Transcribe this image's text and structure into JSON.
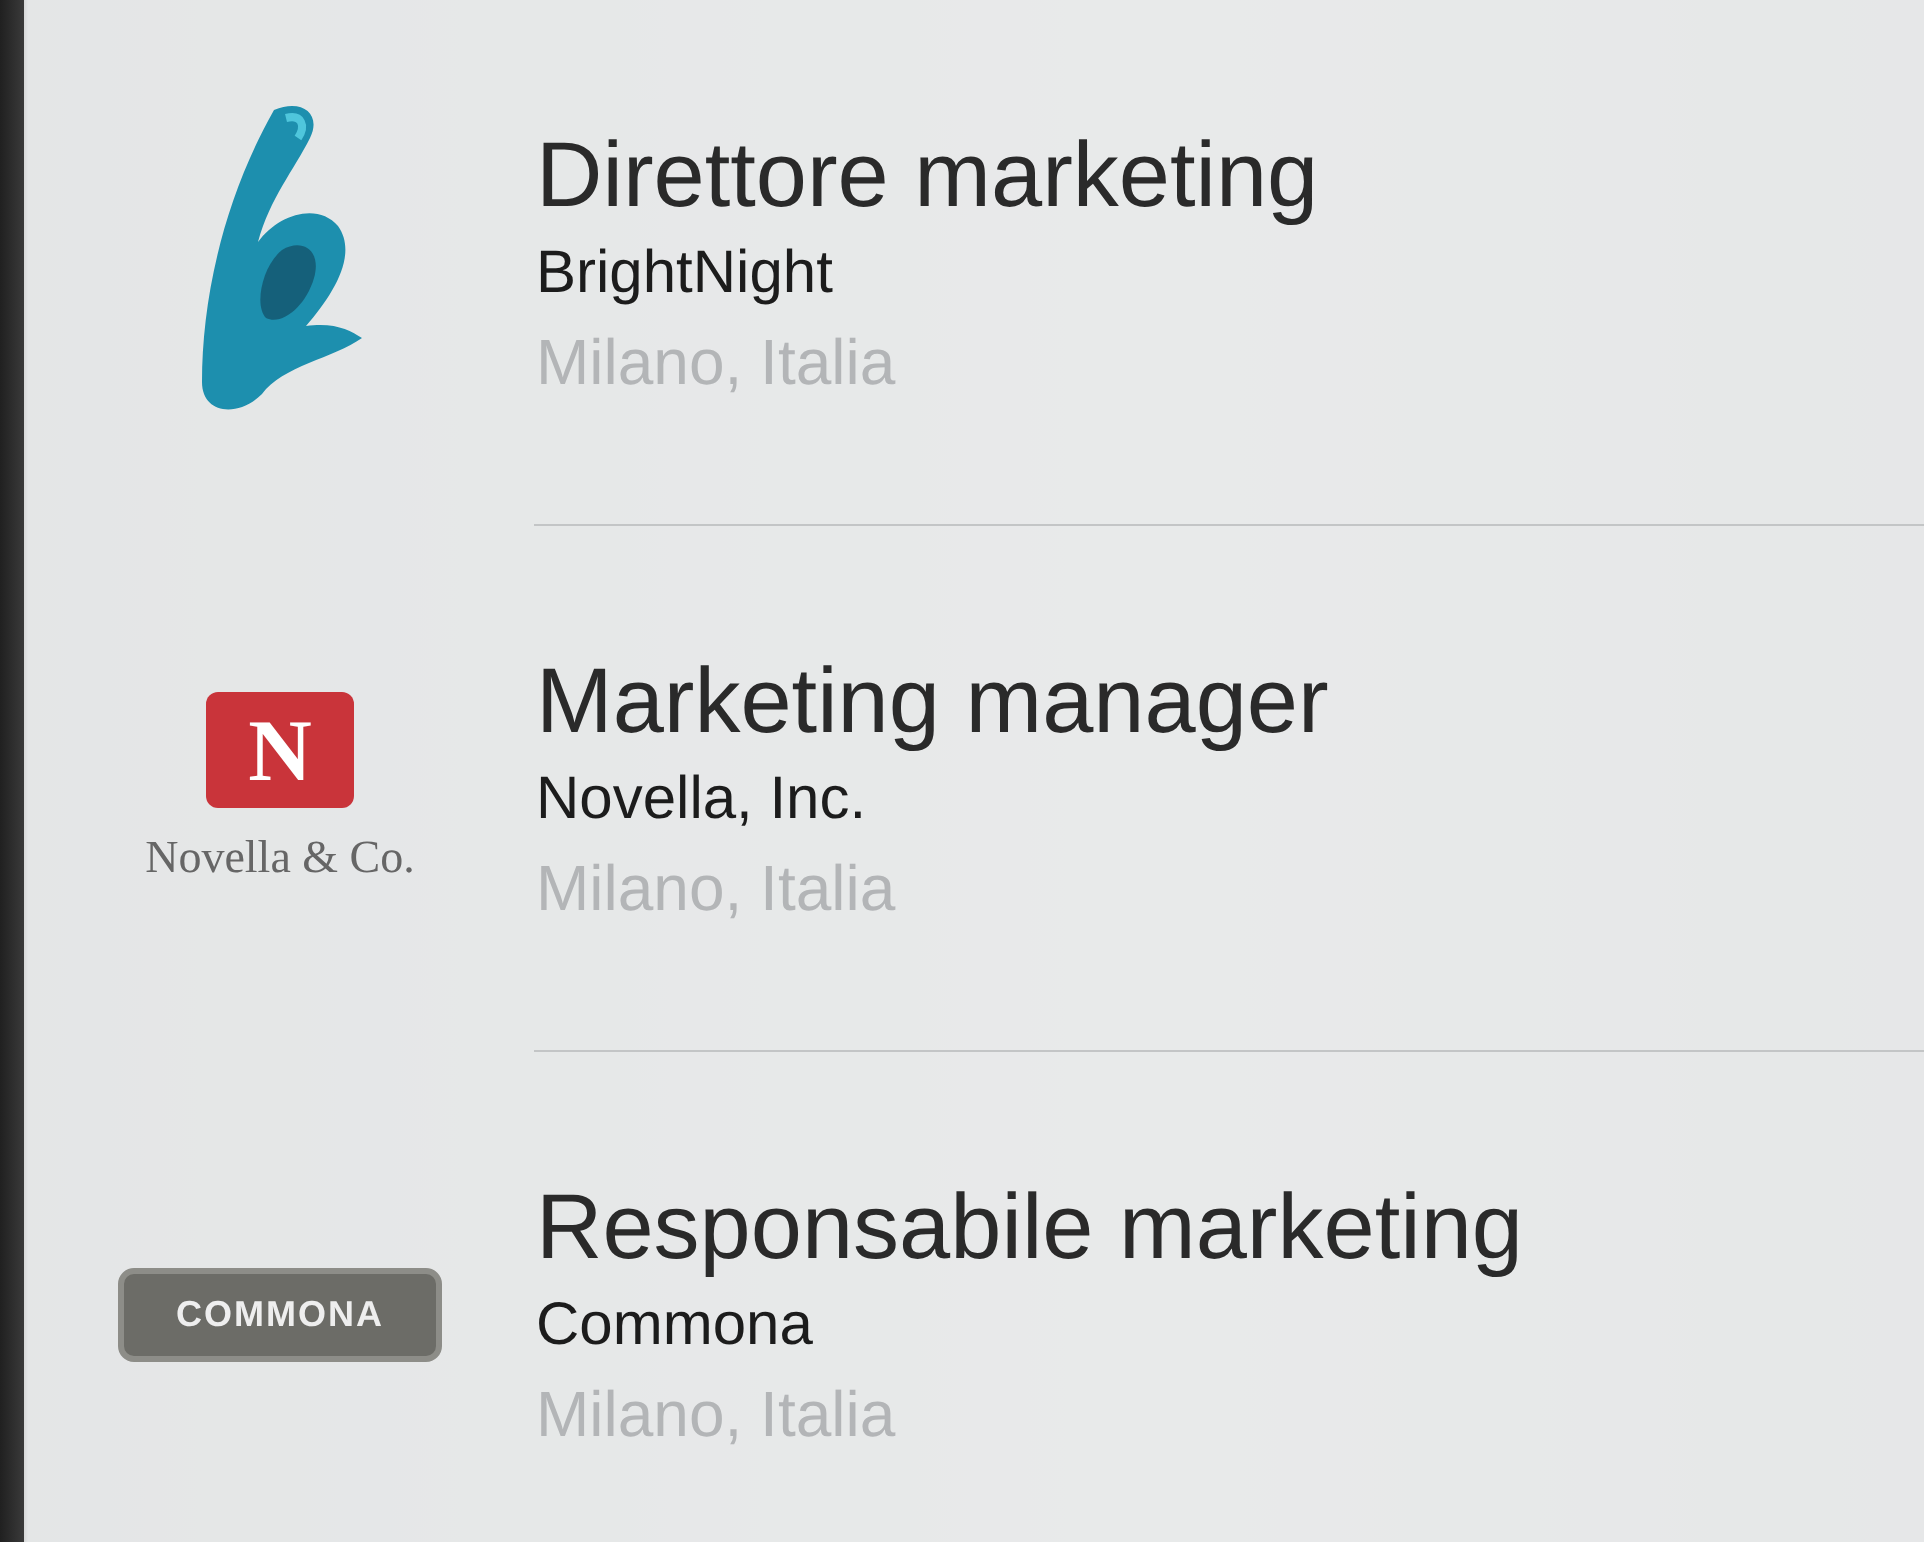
{
  "jobs": [
    {
      "title": "Direttore marketing",
      "company": "BrightNight",
      "location": "Milano, Italia",
      "logo": {
        "kind": "swirl"
      }
    },
    {
      "title": "Marketing manager",
      "company": "Novella, Inc.",
      "location": "Milano, Italia",
      "logo": {
        "kind": "book",
        "mark": "N",
        "text": "Novella & Co."
      }
    },
    {
      "title": "Responsabile marketing",
      "company": "Commona",
      "location": "Milano, Italia",
      "logo": {
        "kind": "plaque",
        "text": "COMMONA"
      }
    }
  ]
}
